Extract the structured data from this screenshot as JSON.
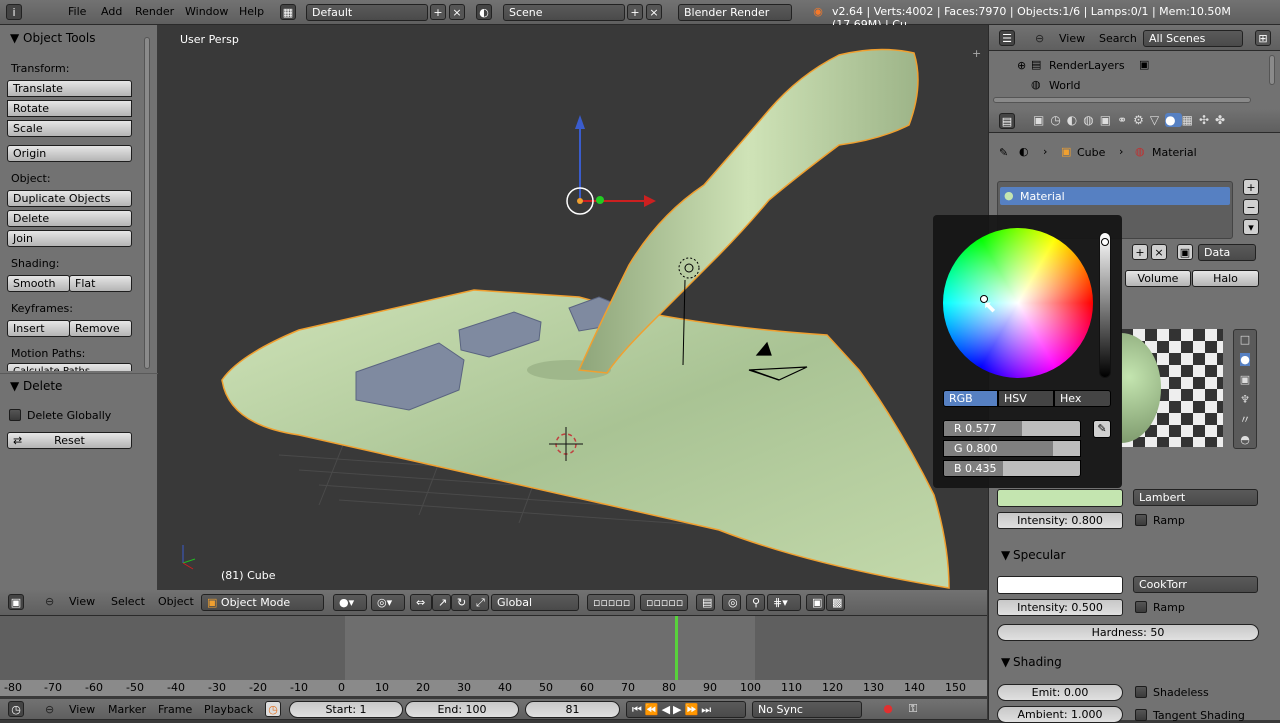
{
  "topbar": {
    "menus": [
      "File",
      "Add",
      "Render",
      "Window",
      "Help"
    ],
    "layout": "Default",
    "scene": "Scene",
    "engine": "Blender Render",
    "stats": "v2.64 | Verts:4002 | Faces:7970 | Objects:1/6 | Lamps:0/1 | Mem:10.50M (17.69M) | Cu"
  },
  "toolshelf": {
    "title": "Object Tools",
    "transform_label": "Transform:",
    "translate": "Translate",
    "rotate": "Rotate",
    "scale": "Scale",
    "origin": "Origin",
    "object_label": "Object:",
    "duplicate": "Duplicate Objects",
    "delete": "Delete",
    "join": "Join",
    "shading_label": "Shading:",
    "smooth": "Smooth",
    "flat": "Flat",
    "keyframes_label": "Keyframes:",
    "insert": "Insert",
    "remove": "Remove",
    "motion_label": "Motion Paths:",
    "calc": "Calculate Paths"
  },
  "operator": {
    "title": "Delete",
    "globally": "Delete Globally",
    "reset": "Reset"
  },
  "viewport": {
    "view_name": "User Persp",
    "object_info": "(81) Cube"
  },
  "view3d_header": {
    "view": "View",
    "select": "Select",
    "object": "Object",
    "mode": "Object Mode",
    "orientation": "Global"
  },
  "timeline": {
    "ticks": [
      "-80",
      "-70",
      "-60",
      "-50",
      "-40",
      "-30",
      "-20",
      "-10",
      "0",
      "10",
      "20",
      "30",
      "40",
      "50",
      "60",
      "70",
      "80",
      "90",
      "100",
      "110",
      "120",
      "130",
      "140",
      "150"
    ],
    "current_frame": 81,
    "view": "View",
    "marker": "Marker",
    "frame": "Frame",
    "playback": "Playback",
    "start": "Start: 1",
    "end": "End: 100",
    "frame_field": "81",
    "sync": "No Sync"
  },
  "outliner": {
    "view": "View",
    "search": "Search",
    "filter": "All Scenes",
    "items": [
      "RenderLayers",
      "World"
    ]
  },
  "properties": {
    "breadcrumb_obj": "Cube",
    "breadcrumb_mat": "Material",
    "material_slot": "Material",
    "data_label": "Data",
    "tab_volume": "Volume",
    "tab_halo": "Halo",
    "diffuse_shader": "Lambert",
    "diffuse_intensity": "Intensity: 0.800",
    "ramp": "Ramp",
    "specular_title": "Specular",
    "specular_shader": "CookTorr",
    "specular_intensity": "Intensity: 0.500",
    "hardness": "Hardness: 50",
    "shading_title": "Shading",
    "emit": "Emit: 0.00",
    "ambient": "Ambient: 1.000",
    "shadeless": "Shadeless",
    "tangent": "Tangent Shading"
  },
  "colorpicker": {
    "tab_rgb": "RGB",
    "tab_hsv": "HSV",
    "tab_hex": "Hex",
    "r": "R 0.577",
    "g": "G 0.800",
    "b": "B 0.435",
    "r_value": 0.577,
    "g_value": 0.8,
    "b_value": 0.435,
    "color": "#c4e5b0"
  },
  "colors": {
    "selected_blue": "#5680c2",
    "wire_orange": "#f0a030",
    "mesh_green": "#b7cf9f"
  }
}
